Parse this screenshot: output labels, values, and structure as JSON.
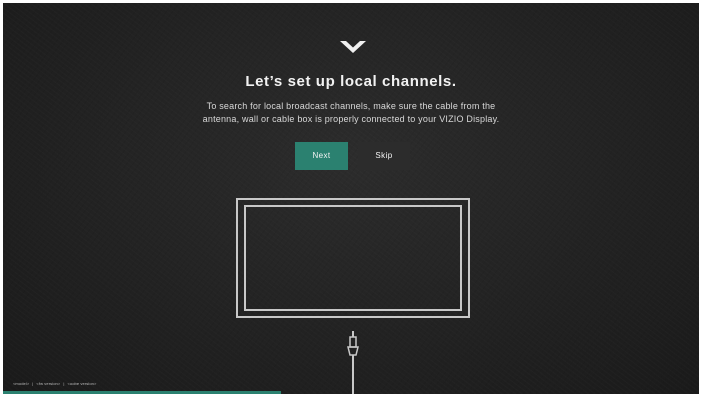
{
  "header": {
    "logo_icon": "vizio-v-icon",
    "title": "Let’s set up local channels."
  },
  "description": {
    "line1": "To search for local broadcast channels, make sure the cable from the",
    "line2": "antenna, wall or cable box is properly connected to your VIZIO Display."
  },
  "buttons": {
    "next_label": "Next",
    "skip_label": "Skip"
  },
  "illustration": {
    "icon": "tv-with-cable-icon"
  },
  "footer": {
    "model": "<model>",
    "sep1": "|",
    "fw_version": "<fw version>",
    "sep2": "|",
    "oobe_version": "<oobe version>"
  },
  "progress": {
    "fraction": 0.4
  },
  "colors": {
    "accent": "#2b8170",
    "background": "#222222",
    "secondary_button": "#2c2c2c",
    "text": "#f2f2f2"
  }
}
